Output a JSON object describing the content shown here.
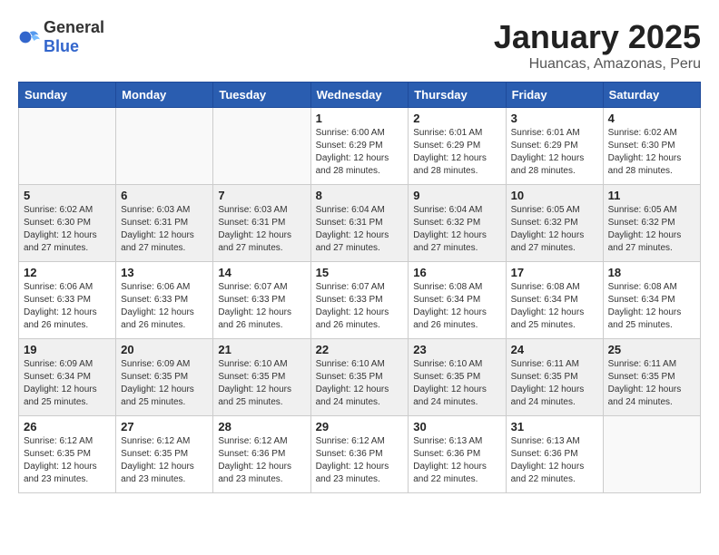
{
  "header": {
    "logo_general": "General",
    "logo_blue": "Blue",
    "month_title": "January 2025",
    "location": "Huancas, Amazonas, Peru"
  },
  "days_of_week": [
    "Sunday",
    "Monday",
    "Tuesday",
    "Wednesday",
    "Thursday",
    "Friday",
    "Saturday"
  ],
  "weeks": [
    [
      {
        "day": "",
        "info": ""
      },
      {
        "day": "",
        "info": ""
      },
      {
        "day": "",
        "info": ""
      },
      {
        "day": "1",
        "info": "Sunrise: 6:00 AM\nSunset: 6:29 PM\nDaylight: 12 hours\nand 28 minutes."
      },
      {
        "day": "2",
        "info": "Sunrise: 6:01 AM\nSunset: 6:29 PM\nDaylight: 12 hours\nand 28 minutes."
      },
      {
        "day": "3",
        "info": "Sunrise: 6:01 AM\nSunset: 6:29 PM\nDaylight: 12 hours\nand 28 minutes."
      },
      {
        "day": "4",
        "info": "Sunrise: 6:02 AM\nSunset: 6:30 PM\nDaylight: 12 hours\nand 28 minutes."
      }
    ],
    [
      {
        "day": "5",
        "info": "Sunrise: 6:02 AM\nSunset: 6:30 PM\nDaylight: 12 hours\nand 27 minutes."
      },
      {
        "day": "6",
        "info": "Sunrise: 6:03 AM\nSunset: 6:31 PM\nDaylight: 12 hours\nand 27 minutes."
      },
      {
        "day": "7",
        "info": "Sunrise: 6:03 AM\nSunset: 6:31 PM\nDaylight: 12 hours\nand 27 minutes."
      },
      {
        "day": "8",
        "info": "Sunrise: 6:04 AM\nSunset: 6:31 PM\nDaylight: 12 hours\nand 27 minutes."
      },
      {
        "day": "9",
        "info": "Sunrise: 6:04 AM\nSunset: 6:32 PM\nDaylight: 12 hours\nand 27 minutes."
      },
      {
        "day": "10",
        "info": "Sunrise: 6:05 AM\nSunset: 6:32 PM\nDaylight: 12 hours\nand 27 minutes."
      },
      {
        "day": "11",
        "info": "Sunrise: 6:05 AM\nSunset: 6:32 PM\nDaylight: 12 hours\nand 27 minutes."
      }
    ],
    [
      {
        "day": "12",
        "info": "Sunrise: 6:06 AM\nSunset: 6:33 PM\nDaylight: 12 hours\nand 26 minutes."
      },
      {
        "day": "13",
        "info": "Sunrise: 6:06 AM\nSunset: 6:33 PM\nDaylight: 12 hours\nand 26 minutes."
      },
      {
        "day": "14",
        "info": "Sunrise: 6:07 AM\nSunset: 6:33 PM\nDaylight: 12 hours\nand 26 minutes."
      },
      {
        "day": "15",
        "info": "Sunrise: 6:07 AM\nSunset: 6:33 PM\nDaylight: 12 hours\nand 26 minutes."
      },
      {
        "day": "16",
        "info": "Sunrise: 6:08 AM\nSunset: 6:34 PM\nDaylight: 12 hours\nand 26 minutes."
      },
      {
        "day": "17",
        "info": "Sunrise: 6:08 AM\nSunset: 6:34 PM\nDaylight: 12 hours\nand 25 minutes."
      },
      {
        "day": "18",
        "info": "Sunrise: 6:08 AM\nSunset: 6:34 PM\nDaylight: 12 hours\nand 25 minutes."
      }
    ],
    [
      {
        "day": "19",
        "info": "Sunrise: 6:09 AM\nSunset: 6:34 PM\nDaylight: 12 hours\nand 25 minutes."
      },
      {
        "day": "20",
        "info": "Sunrise: 6:09 AM\nSunset: 6:35 PM\nDaylight: 12 hours\nand 25 minutes."
      },
      {
        "day": "21",
        "info": "Sunrise: 6:10 AM\nSunset: 6:35 PM\nDaylight: 12 hours\nand 25 minutes."
      },
      {
        "day": "22",
        "info": "Sunrise: 6:10 AM\nSunset: 6:35 PM\nDaylight: 12 hours\nand 24 minutes."
      },
      {
        "day": "23",
        "info": "Sunrise: 6:10 AM\nSunset: 6:35 PM\nDaylight: 12 hours\nand 24 minutes."
      },
      {
        "day": "24",
        "info": "Sunrise: 6:11 AM\nSunset: 6:35 PM\nDaylight: 12 hours\nand 24 minutes."
      },
      {
        "day": "25",
        "info": "Sunrise: 6:11 AM\nSunset: 6:35 PM\nDaylight: 12 hours\nand 24 minutes."
      }
    ],
    [
      {
        "day": "26",
        "info": "Sunrise: 6:12 AM\nSunset: 6:35 PM\nDaylight: 12 hours\nand 23 minutes."
      },
      {
        "day": "27",
        "info": "Sunrise: 6:12 AM\nSunset: 6:35 PM\nDaylight: 12 hours\nand 23 minutes."
      },
      {
        "day": "28",
        "info": "Sunrise: 6:12 AM\nSunset: 6:36 PM\nDaylight: 12 hours\nand 23 minutes."
      },
      {
        "day": "29",
        "info": "Sunrise: 6:12 AM\nSunset: 6:36 PM\nDaylight: 12 hours\nand 23 minutes."
      },
      {
        "day": "30",
        "info": "Sunrise: 6:13 AM\nSunset: 6:36 PM\nDaylight: 12 hours\nand 22 minutes."
      },
      {
        "day": "31",
        "info": "Sunrise: 6:13 AM\nSunset: 6:36 PM\nDaylight: 12 hours\nand 22 minutes."
      },
      {
        "day": "",
        "info": ""
      }
    ]
  ]
}
